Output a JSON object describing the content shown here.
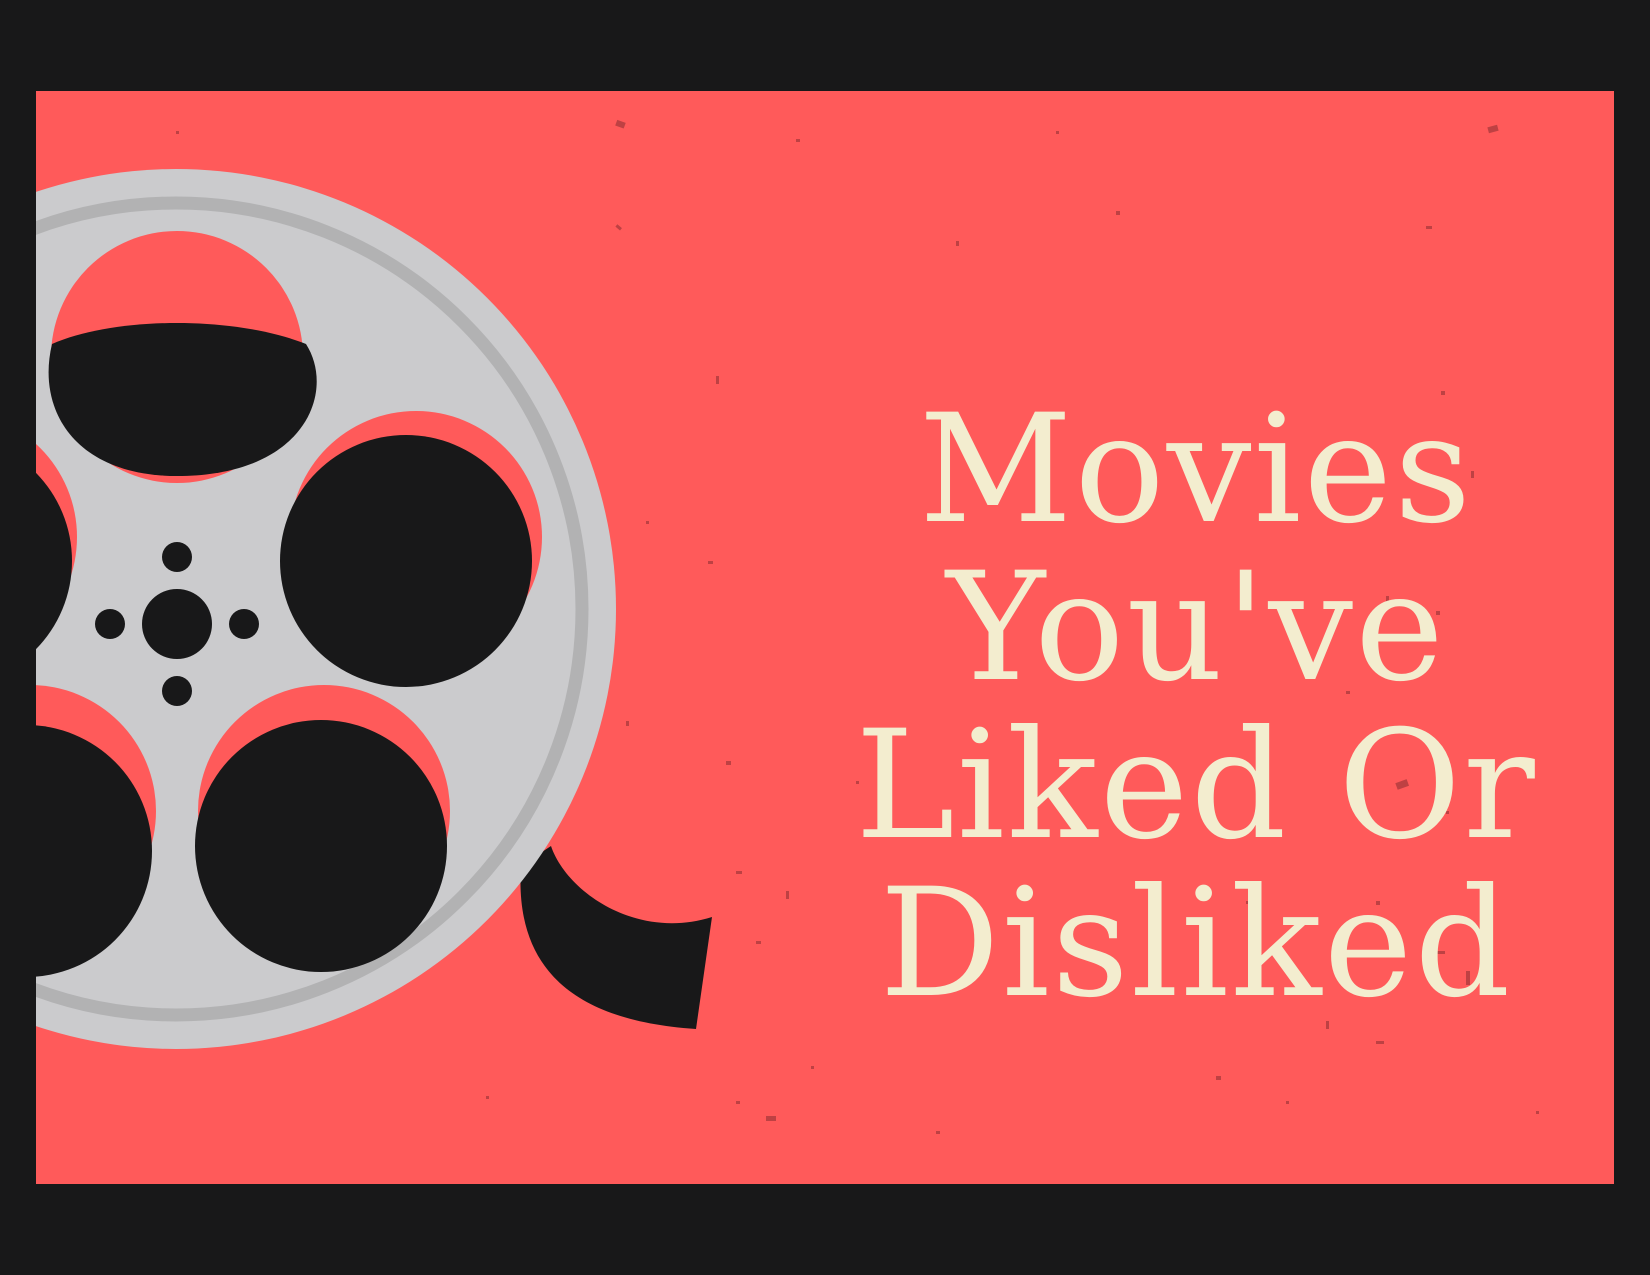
{
  "title": {
    "lines": [
      "Movies",
      "You've",
      "Liked Or",
      "Disliked"
    ]
  },
  "colors": {
    "frame": "#181819",
    "panel": "#ff5a5a",
    "reel_metal": "#cbcbcd",
    "reel_groove": "#b2b2b3",
    "film": "#181819",
    "title_text": "#f3edcf"
  },
  "icons": {
    "illustration": "film-reel-icon"
  }
}
